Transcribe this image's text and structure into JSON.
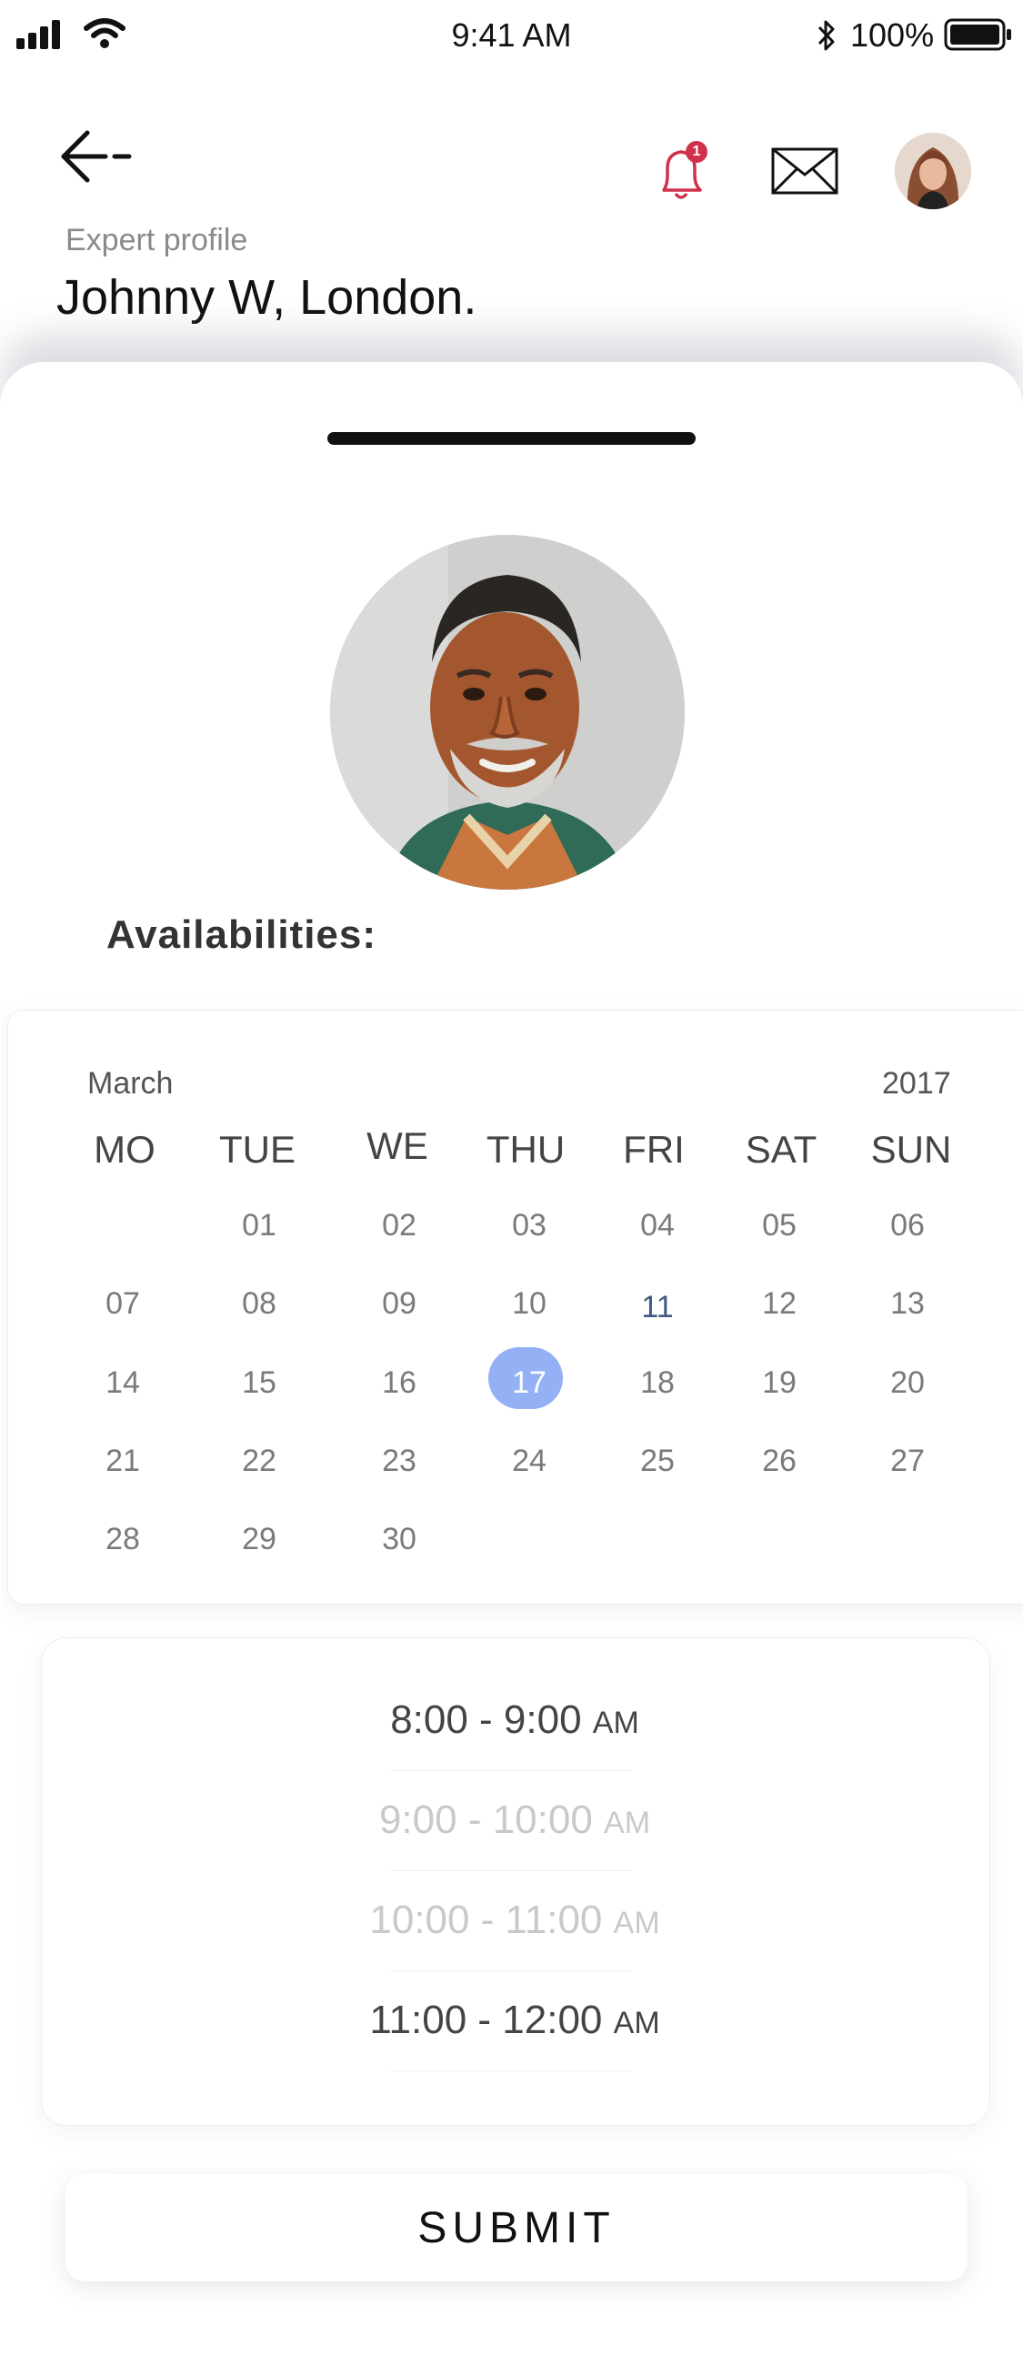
{
  "status_bar": {
    "time": "9:41 AM",
    "battery": "100%"
  },
  "header": {
    "subtitle": "Expert profile",
    "title": "Johnny W, London.",
    "notification_count": "1"
  },
  "availability_label": "Availabilities:",
  "calendar": {
    "month": "March",
    "year": "2017",
    "weekdays": [
      "MO",
      "TUE",
      "WE",
      "THU",
      "FRI",
      "SAT",
      "SUN"
    ],
    "weeks": [
      [
        "",
        "01",
        "02",
        "03",
        "04",
        "05",
        "06"
      ],
      [
        "07",
        "08",
        "09",
        "10",
        "11",
        "12",
        "13"
      ],
      [
        "14",
        "15",
        "16",
        "17",
        "18",
        "19",
        "20"
      ],
      [
        "21",
        "22",
        "23",
        "24",
        "25",
        "26",
        "27"
      ],
      [
        "28",
        "29",
        "30",
        "",
        "",
        "",
        ""
      ]
    ],
    "selected_day": "17",
    "selected_color": "#93b1f4"
  },
  "time_slots": [
    {
      "range": "8:00 - 9:00",
      "period": "AM",
      "state": "active"
    },
    {
      "range": "9:00 - 10:00",
      "period": "AM",
      "state": "faded"
    },
    {
      "range": "10:00 - 11:00",
      "period": "AM",
      "state": "faded"
    },
    {
      "range": "11:00 - 12:00",
      "period": "AM",
      "state": "active"
    }
  ],
  "submit_label": "SUBMIT",
  "colors": {
    "notification_accent": "#d0314a"
  }
}
